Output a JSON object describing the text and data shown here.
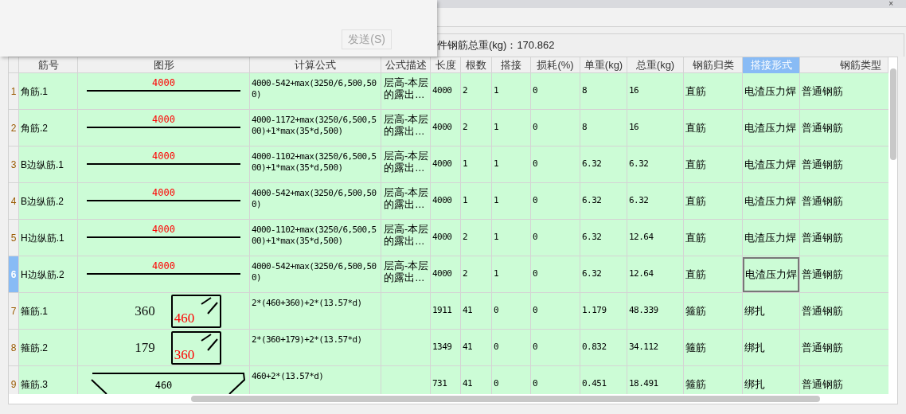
{
  "popup": {
    "send_button": "发送(S)"
  },
  "window": {
    "close": "×"
  },
  "summary": "件钢筋总重(kg)：170.862",
  "table": {
    "columns": [
      {
        "label": "筋号",
        "selected": false
      },
      {
        "label": "图形",
        "selected": false
      },
      {
        "label": "计算公式",
        "selected": false
      },
      {
        "label": "公式描述",
        "selected": false
      },
      {
        "label": "长度",
        "selected": false
      },
      {
        "label": "根数",
        "selected": false
      },
      {
        "label": "搭接",
        "selected": false
      },
      {
        "label": "损耗(%)",
        "selected": false
      },
      {
        "label": "单重(kg)",
        "selected": false
      },
      {
        "label": "总重(kg)",
        "selected": false
      },
      {
        "label": "钢筋归类",
        "selected": false
      },
      {
        "label": "搭接形式",
        "selected": true
      },
      {
        "label": "钢筋类型",
        "selected": false
      }
    ],
    "rows": [
      {
        "number": "1",
        "selected": false,
        "name": "角筋.1",
        "shape": {
          "kind": "line",
          "label": "4000"
        },
        "formula": "4000-542+max(3250/6,500,500)",
        "description": "层高-本层的露出…",
        "length": "4000",
        "count": "2",
        "laps": "1",
        "loss": "0",
        "unit_weight": "8",
        "total_weight": "16",
        "category": "直筋",
        "lap_type": "电渣压力焊",
        "rebar_type": "普通钢筋"
      },
      {
        "number": "2",
        "selected": false,
        "name": "角筋.2",
        "shape": {
          "kind": "line",
          "label": "4000"
        },
        "formula": "4000-1172+max(3250/6,500,500)+1*max(35*d,500)",
        "description": "层高-本层的露出…",
        "length": "4000",
        "count": "2",
        "laps": "1",
        "loss": "0",
        "unit_weight": "8",
        "total_weight": "16",
        "category": "直筋",
        "lap_type": "电渣压力焊",
        "rebar_type": "普通钢筋"
      },
      {
        "number": "3",
        "selected": false,
        "name": "B边纵筋.1",
        "shape": {
          "kind": "line",
          "label": "4000"
        },
        "formula": "4000-1102+max(3250/6,500,500)+1*max(35*d,500)",
        "description": "层高-本层的露出…",
        "length": "4000",
        "count": "1",
        "laps": "1",
        "loss": "0",
        "unit_weight": "6.32",
        "total_weight": "6.32",
        "category": "直筋",
        "lap_type": "电渣压力焊",
        "rebar_type": "普通钢筋"
      },
      {
        "number": "4",
        "selected": false,
        "name": "B边纵筋.2",
        "shape": {
          "kind": "line",
          "label": "4000"
        },
        "formula": "4000-542+max(3250/6,500,500)",
        "description": "层高-本层的露出…",
        "length": "4000",
        "count": "1",
        "laps": "1",
        "loss": "0",
        "unit_weight": "6.32",
        "total_weight": "6.32",
        "category": "直筋",
        "lap_type": "电渣压力焊",
        "rebar_type": "普通钢筋"
      },
      {
        "number": "5",
        "selected": false,
        "name": "H边纵筋.1",
        "shape": {
          "kind": "line",
          "label": "4000"
        },
        "formula": "4000-1102+max(3250/6,500,500)+1*max(35*d,500)",
        "description": "层高-本层的露出…",
        "length": "4000",
        "count": "2",
        "laps": "1",
        "loss": "0",
        "unit_weight": "6.32",
        "total_weight": "12.64",
        "category": "直筋",
        "lap_type": "电渣压力焊",
        "rebar_type": "普通钢筋"
      },
      {
        "number": "6",
        "selected": true,
        "name": "H边纵筋.2",
        "shape": {
          "kind": "line",
          "label": "4000"
        },
        "formula": "4000-542+max(3250/6,500,500)",
        "description": "层高-本层的露出…",
        "length": "4000",
        "count": "2",
        "laps": "1",
        "loss": "0",
        "unit_weight": "6.32",
        "total_weight": "12.64",
        "category": "直筋",
        "lap_type": "电渣压力焊",
        "rebar_type": "普通钢筋"
      },
      {
        "number": "7",
        "selected": false,
        "name": "箍筋.1",
        "shape": {
          "kind": "stirrup",
          "side": "360",
          "inner": "460"
        },
        "formula": "2*(460+360)+2*(13.57*d)",
        "length": "1911",
        "count": "41",
        "laps": "0",
        "loss": "0",
        "unit_weight": "1.179",
        "total_weight": "48.339",
        "category": "箍筋",
        "lap_type": "绑扎",
        "rebar_type": "普通钢筋"
      },
      {
        "number": "8",
        "selected": false,
        "name": "箍筋.2",
        "shape": {
          "kind": "stirrup",
          "side": "179",
          "inner": "360"
        },
        "formula": "2*(360+179)+2*(13.57*d)",
        "length": "1349",
        "count": "41",
        "laps": "0",
        "loss": "0",
        "unit_weight": "0.832",
        "total_weight": "34.112",
        "category": "箍筋",
        "lap_type": "绑扎",
        "rebar_type": "普通钢筋"
      },
      {
        "number": "9",
        "selected": false,
        "name": "箍筋.3",
        "shape": {
          "kind": "trapezoid",
          "label": "460"
        },
        "formula": "460+2*(13.57*d)",
        "length": "731",
        "count": "41",
        "laps": "0",
        "loss": "0",
        "unit_weight": "0.451",
        "total_weight": "18.491",
        "category": "箍筋",
        "lap_type": "绑扎",
        "rebar_type": "普通钢筋"
      }
    ]
  }
}
